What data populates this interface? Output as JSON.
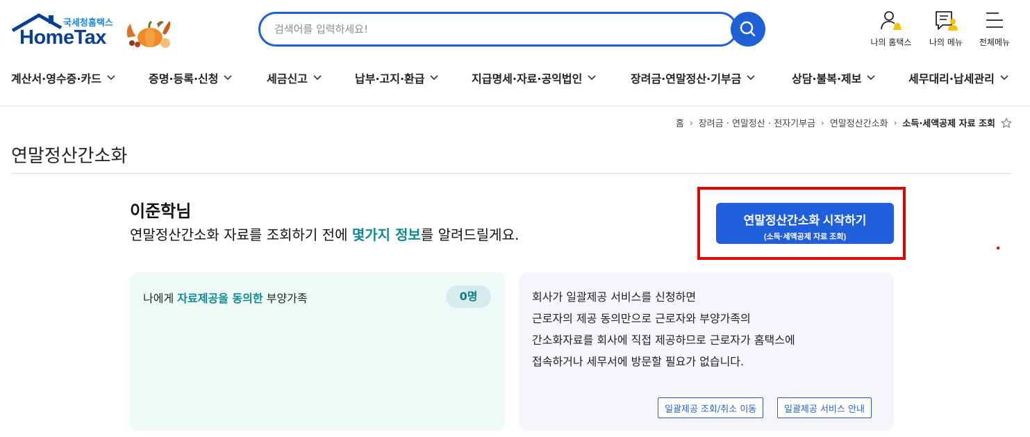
{
  "header": {
    "logo_sub": "국세청홈택스",
    "logo_main": "HomeTax",
    "search_placeholder": "검색어를 입력하세요!",
    "icons": [
      {
        "label": "나의 홈택스",
        "icon": "my-hometax-icon"
      },
      {
        "label": "나의 메뉴",
        "icon": "my-menu-icon"
      },
      {
        "label": "전체메뉴",
        "icon": "hamburger-icon"
      }
    ]
  },
  "nav": {
    "items": [
      {
        "label": "계산서·영수증·카드"
      },
      {
        "label": "증명·등록·신청"
      },
      {
        "label": "세금신고"
      },
      {
        "label": "납부·고지·환급"
      },
      {
        "label": "지급명세·자료·공익법인"
      },
      {
        "label": "장려금·연말정산·기부금"
      },
      {
        "label": "상담·불복·제보"
      },
      {
        "label": "세무대리·납세관리"
      }
    ]
  },
  "breadcrumb": {
    "items": [
      "홈",
      "장려금 · 연말정산 · 전자기부금",
      "연말정산간소화",
      "소득·세액공제 자료 조회"
    ]
  },
  "page": {
    "title": "연말정산간소화",
    "user_name": "이준학님",
    "greeting_pre": "연말정산간소화 자료를 조회하기 전에 ",
    "greeting_hl": "몇가지 정보",
    "greeting_post": "를 알려드릴게요.",
    "start_button": {
      "line1": "연말정산간소화 시작하기",
      "line2": "(소득·세액공제 자료 조회)"
    }
  },
  "card_left": {
    "label_pre": "나에게 ",
    "label_hl": "자료제공을 동의한",
    "label_post": " 부양가족",
    "count": "0명"
  },
  "card_right": {
    "lines": [
      "회사가 일괄제공 서비스를 신청하면",
      "근로자의 제공 동의만으로 근로자와 부양가족의",
      "간소화자료를 회사에 직접 제공하므로 근로자가 홈택스에",
      "접속하거나 세무서에 방문할 필요가 없습니다."
    ],
    "buttons": [
      "일괄제공 조회/취소 이동",
      "일괄제공 서비스 안내"
    ]
  },
  "colors": {
    "brand_blue": "#1e5fd6",
    "highlight_teal": "#0f8a8f",
    "alert_red": "#e10000"
  }
}
